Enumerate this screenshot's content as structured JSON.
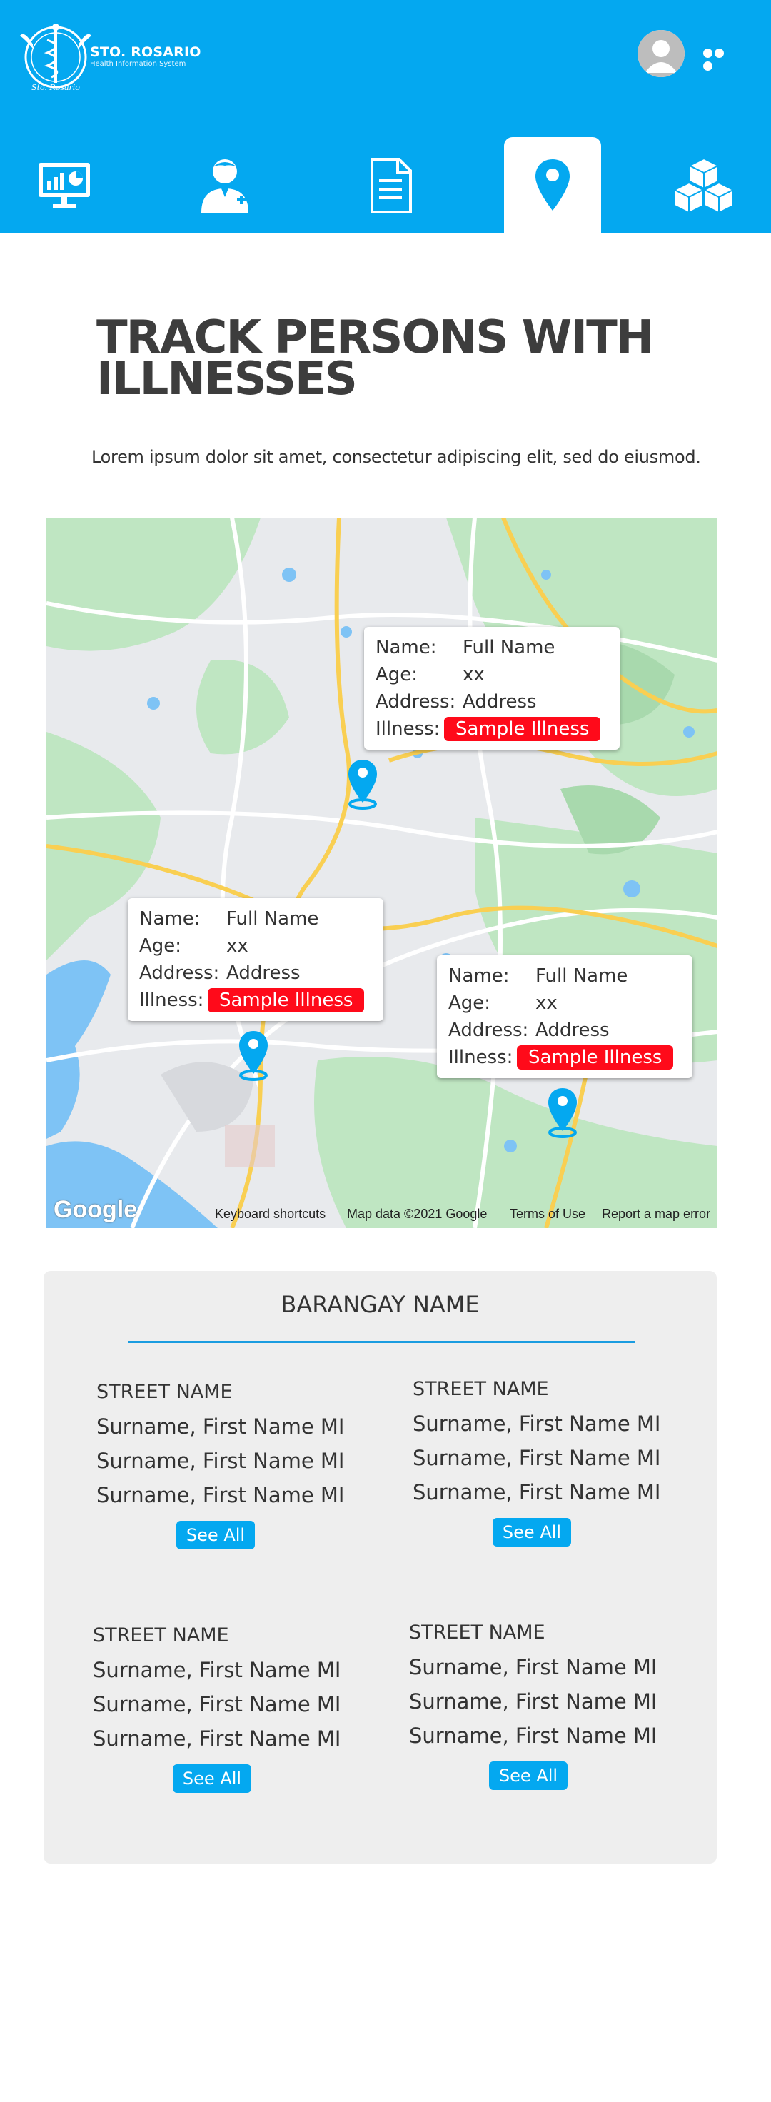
{
  "brand": {
    "title": "STO. ROSARIO",
    "subtitle": "Health Information System",
    "seal_text": "Sto. Rosario"
  },
  "colors": {
    "primary": "#04a8f0",
    "illness_badge": "#ff0a1a",
    "panel_bg": "#eeeeee"
  },
  "header": {
    "avatar_icon": "user-avatar-icon",
    "menu_icon": "more-dots-icon"
  },
  "nav": {
    "tabs": [
      {
        "icon": "dashboard-chart-icon",
        "active": false
      },
      {
        "icon": "doctor-icon",
        "active": false
      },
      {
        "icon": "document-icon",
        "active": false
      },
      {
        "icon": "location-pin-icon",
        "active": true
      },
      {
        "icon": "inventory-boxes-icon",
        "active": false
      }
    ]
  },
  "page": {
    "title": "TRACK PERSONS WITH ILLNESSES",
    "intro": "Lorem ipsum dolor sit amet, consectetur adipiscing elit, sed do eiusmod."
  },
  "map": {
    "popups": [
      {
        "name_label": "Name:",
        "name": "Full Name",
        "age_label": "Age:",
        "age": "xx",
        "address_label": "Address:",
        "address": "Address",
        "illness_label": "Illness:",
        "illness": "Sample Illness"
      },
      {
        "name_label": "Name:",
        "name": "Full Name",
        "age_label": "Age:",
        "age": "xx",
        "address_label": "Address:",
        "address": "Address",
        "illness_label": "Illness:",
        "illness": "Sample Illness"
      },
      {
        "name_label": "Name:",
        "name": "Full Name",
        "age_label": "Age:",
        "age": "xx",
        "address_label": "Address:",
        "address": "Address",
        "illness_label": "Illness:",
        "illness": "Sample Illness"
      }
    ],
    "footer": {
      "google": "Google",
      "shortcuts": "Keyboard shortcuts",
      "map_data": "Map data ©2021 Google",
      "terms": "Terms of Use",
      "report": "Report a map error"
    }
  },
  "barangay": {
    "title": "BARANGAY NAME",
    "streets": [
      {
        "name": "STREET NAME",
        "persons": [
          "Surname, First Name MI",
          "Surname, First Name MI",
          "Surname, First Name MI"
        ],
        "button": "See All"
      },
      {
        "name": "STREET NAME",
        "persons": [
          "Surname, First Name MI",
          "Surname, First Name MI",
          "Surname, First Name MI"
        ],
        "button": "See All"
      },
      {
        "name": "STREET NAME",
        "persons": [
          "Surname, First Name MI",
          "Surname, First Name MI",
          "Surname, First Name MI"
        ],
        "button": "See All"
      },
      {
        "name": "STREET NAME",
        "persons": [
          "Surname, First Name MI",
          "Surname, First Name MI",
          "Surname, First Name MI"
        ],
        "button": "See All"
      }
    ]
  }
}
